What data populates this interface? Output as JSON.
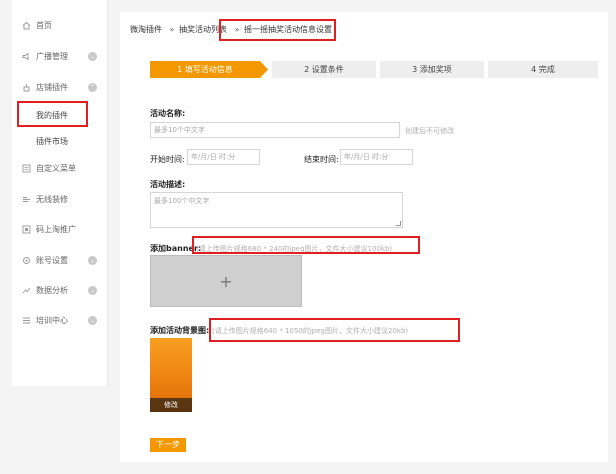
{
  "sidebar": {
    "items": [
      {
        "label": "首页",
        "icon": "home-icon",
        "has_chevron": false
      },
      {
        "label": "广播管理",
        "icon": "broadcast-icon",
        "has_chevron": true
      },
      {
        "label": "店铺插件",
        "icon": "plugin-icon",
        "has_chevron": true
      },
      {
        "label": "我的插件",
        "icon": "",
        "has_chevron": false,
        "sub": true,
        "selected": true
      },
      {
        "label": "插件市场",
        "icon": "",
        "has_chevron": false,
        "sub": true
      },
      {
        "label": "自定义菜单",
        "icon": "menu-icon",
        "has_chevron": false
      },
      {
        "label": "无线装修",
        "icon": "decorate-icon",
        "has_chevron": false
      },
      {
        "label": "码上淘推广",
        "icon": "qrcode-icon",
        "has_chevron": false
      },
      {
        "label": "账号设置",
        "icon": "gear-icon",
        "has_chevron": true
      },
      {
        "label": "数据分析",
        "icon": "chart-icon",
        "has_chevron": true
      },
      {
        "label": "培训中心",
        "icon": "list-icon",
        "has_chevron": true
      }
    ]
  },
  "breadcrumb": {
    "item1": "微淘插件",
    "sep": "»",
    "item2": "抽奖活动列表",
    "item3": "摇一摇抽奖活动信息设置"
  },
  "steps": [
    {
      "label": "1 填写活动信息",
      "active": true
    },
    {
      "label": "2 设置条件",
      "active": false
    },
    {
      "label": "3 添加奖项",
      "active": false
    },
    {
      "label": "4 完成",
      "active": false
    }
  ],
  "form": {
    "name_label": "活动名称:",
    "name_placeholder": "最多10个中文字",
    "name_hint": "创建后不可修改",
    "start_label": "开始时间:",
    "start_placeholder": "年/月/日 时:分",
    "end_label": "结束时间:",
    "end_placeholder": "年/月/日 时:分",
    "desc_label": "活动描述:",
    "desc_placeholder": "最多100个中文字",
    "banner_label": "添加banner:",
    "banner_hint": "(请上传图片规格680 * 240的jpeg图片，文件大小建议100kb)",
    "banner_plus": "+",
    "bg_label": "添加活动背景图:",
    "bg_hint": "(请上传图片规格640 * 1050的jpeg图片，文件大小建议20kb)",
    "bg_edit": "修改",
    "next_label": "下一步"
  },
  "colors": {
    "accent": "#f39800",
    "highlight": "#e02020"
  }
}
